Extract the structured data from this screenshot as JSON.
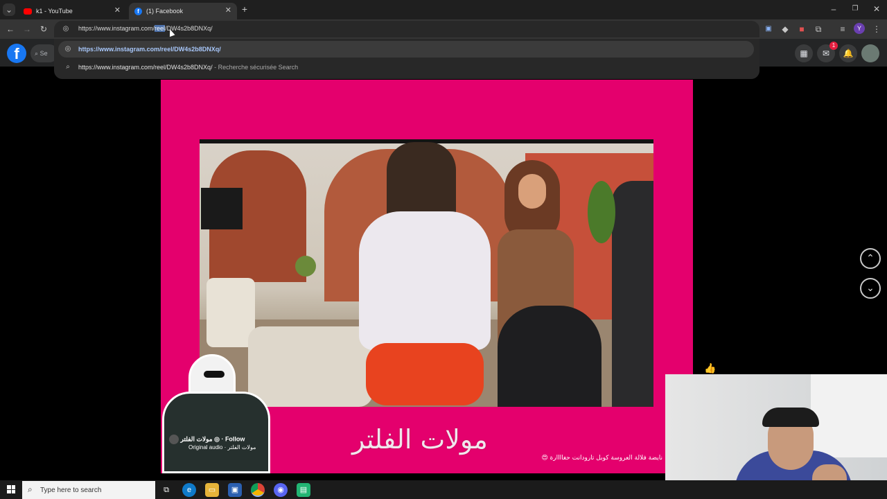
{
  "browser": {
    "tabs": [
      {
        "label": "k1 - YouTube",
        "icon": "youtube-icon",
        "active": false
      },
      {
        "label": "(1) Facebook",
        "icon": "facebook-icon",
        "active": true
      }
    ],
    "new_tab_symbol": "+",
    "close_symbol": "✕",
    "url": {
      "before": "https://www.instagram.com/",
      "selected": "reel",
      "after": "/DW4s2b8DNXq/"
    },
    "suggestions": [
      {
        "text": "https://www.instagram.com/reel/DW4s2b8DNXq/",
        "suffix": "",
        "icon": "globe-icon"
      },
      {
        "text": "https://www.instagram.com/reel/DW4s2b8DNXq/",
        "suffix": " - Recherche sécurisée Search",
        "icon": "search-icon"
      }
    ],
    "profile_letter": "Y"
  },
  "facebook": {
    "logo": "f",
    "search_placeholder": "Se",
    "notification_count": "1"
  },
  "reel": {
    "overlay_title": "مولات الفلتر",
    "author": "مولات الفلتر",
    "follow_label": "Follow",
    "audio": "مولات الفلتر · Original audio",
    "caption": "نايضة فلالة العروسة كوبل تارودانت حغاااارة 😍"
  },
  "taskbar": {
    "search_placeholder": "Type here to search"
  },
  "colors": {
    "reel_bg": "#e4006d",
    "facebook_blue": "#1877f2",
    "link_blue": "#a8c7fa"
  }
}
